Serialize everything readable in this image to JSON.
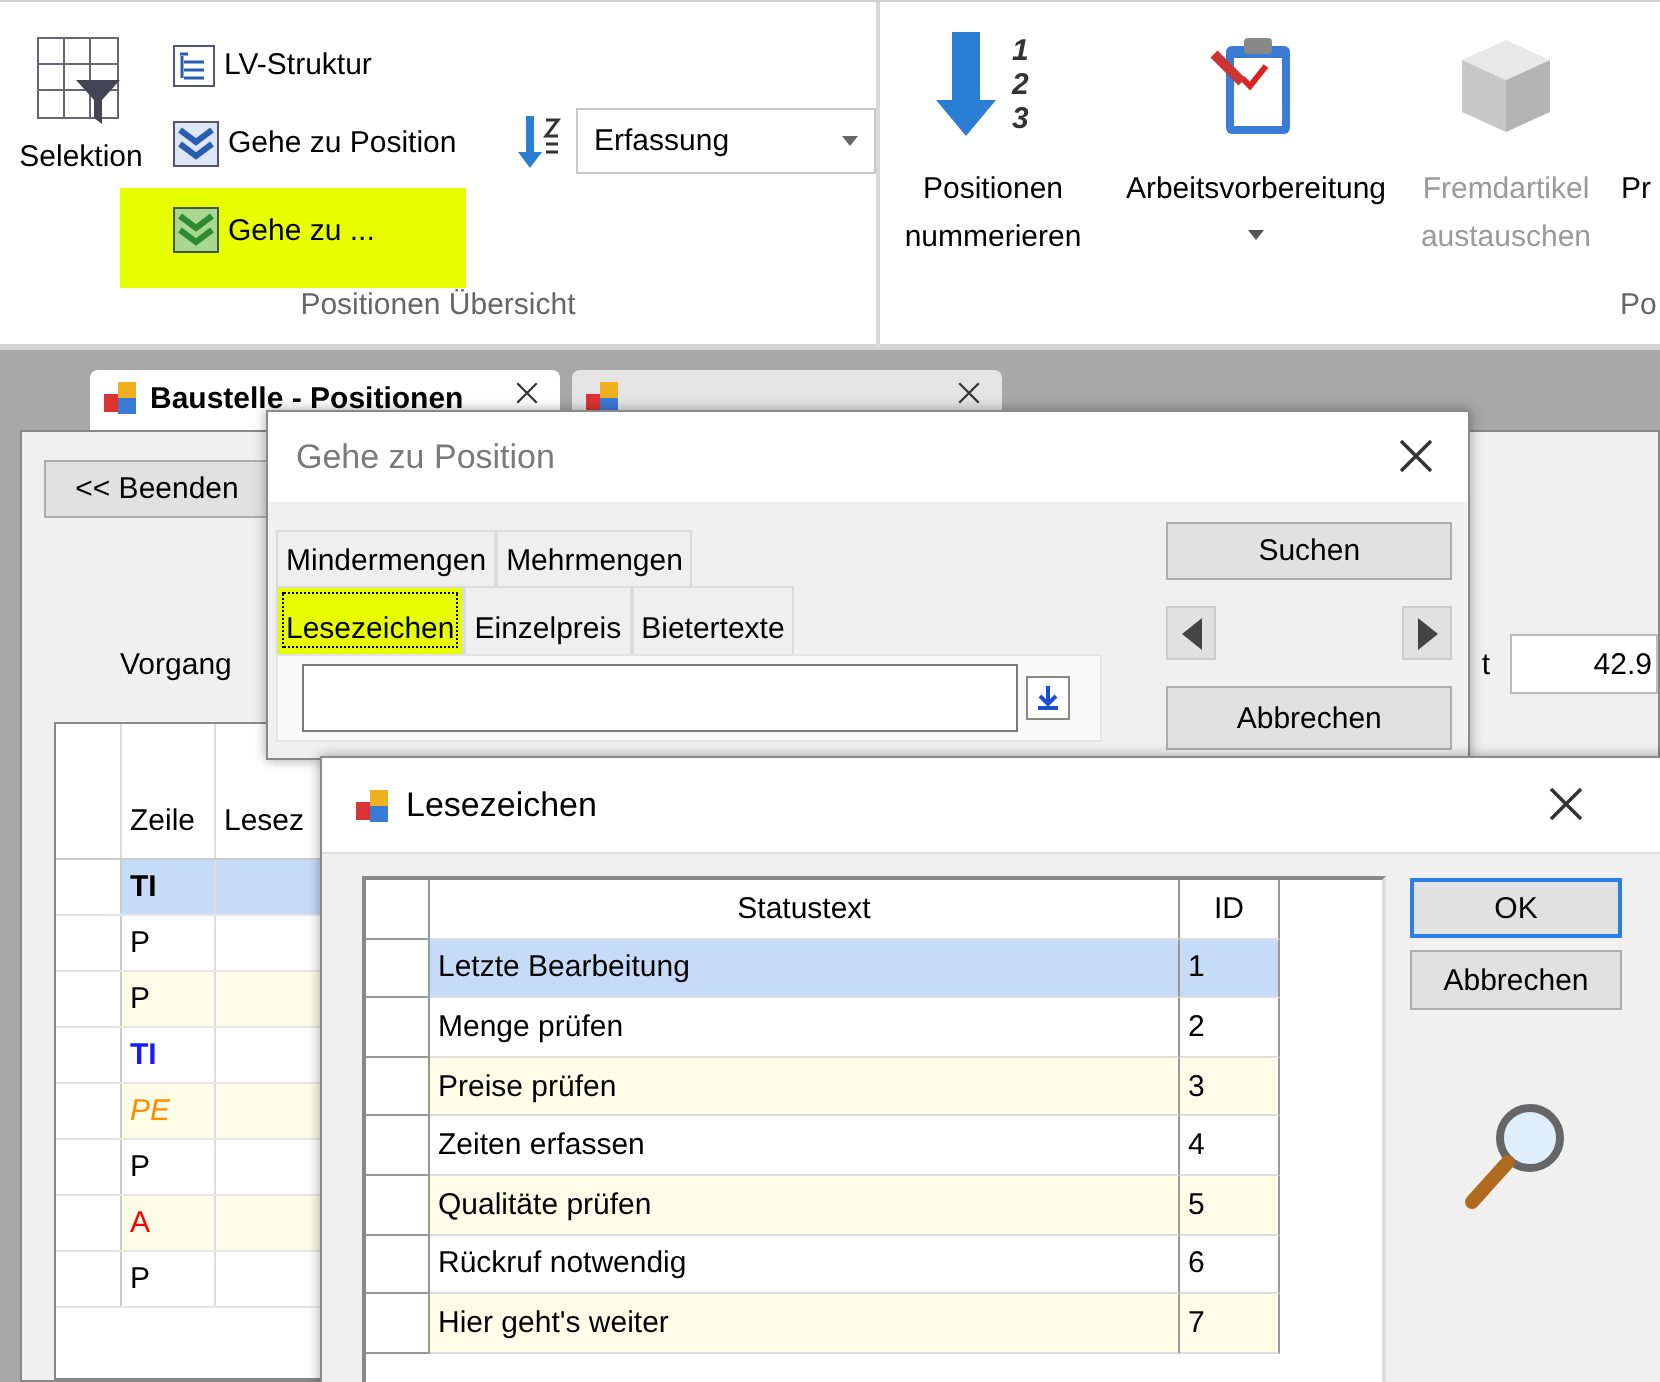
{
  "ribbon": {
    "group_1": {
      "label": "Positionen Übersicht",
      "big_button": {
        "label": "Selektion"
      },
      "small_buttons": [
        {
          "label": "LV-Struktur",
          "kind": "tree",
          "highlighted": false
        },
        {
          "label": "Gehe zu Position",
          "kind": "goto",
          "highlighted": false
        },
        {
          "label": "Gehe zu ...",
          "kind": "goto-green",
          "highlighted": true
        }
      ],
      "sort_combo": {
        "value": "Erfassung"
      }
    },
    "group_2": {
      "label": "Po",
      "buttons": [
        {
          "lines": [
            "Positionen",
            "nummerieren"
          ],
          "kind": "numbering",
          "icon_digits": [
            "1",
            "2",
            "3"
          ],
          "disabled": false,
          "dropdown": false
        },
        {
          "lines": [
            "Arbeitsvorbereitung"
          ],
          "kind": "clipboard",
          "disabled": false,
          "dropdown": true
        },
        {
          "lines": [
            "Fremdartikel",
            "austauschen"
          ],
          "kind": "cube",
          "disabled": true,
          "dropdown": false
        },
        {
          "lines": [
            "Pr"
          ],
          "kind": "none",
          "disabled": false,
          "dropdown": false
        }
      ]
    }
  },
  "document_tabs": [
    {
      "label": "Baustelle - Positionen",
      "selected": true
    },
    {
      "selected": false
    }
  ],
  "main": {
    "back_button": "<< Beenden",
    "vorgang_label": "Vorgang",
    "right_label": "t",
    "right_value": "42.9",
    "grid": {
      "columns": [
        "Zeile",
        "Lesez"
      ],
      "rows": [
        {
          "zeile": "TI",
          "color": "#000000",
          "bold": true,
          "italic": false,
          "selected": true
        },
        {
          "zeile": "P",
          "color": "#000000",
          "bold": false,
          "italic": false,
          "selected": false
        },
        {
          "zeile": "P",
          "color": "#000000",
          "bold": false,
          "italic": false,
          "selected": false
        },
        {
          "zeile": "TI",
          "color": "#1a1aff",
          "bold": true,
          "italic": false,
          "selected": false
        },
        {
          "zeile": "PE",
          "color": "#ff8c00",
          "bold": false,
          "italic": true,
          "selected": false
        },
        {
          "zeile": "P",
          "color": "#000000",
          "bold": false,
          "italic": false,
          "selected": false
        },
        {
          "zeile": "A",
          "color": "#ff0000",
          "bold": false,
          "italic": false,
          "selected": false
        },
        {
          "zeile": "P",
          "color": "#000000",
          "bold": false,
          "italic": false,
          "selected": false
        }
      ]
    }
  },
  "goto_dialog": {
    "title": "Gehe zu Position",
    "tab_rows": [
      [
        {
          "label": "Mindermengen",
          "selected": false,
          "highlighted": false
        },
        {
          "label": "Mehrmengen",
          "selected": false,
          "highlighted": false
        }
      ],
      [
        {
          "label": "Lesezeichen",
          "selected": true,
          "highlighted": true
        },
        {
          "label": "Einzelpreis",
          "selected": false,
          "highlighted": false
        },
        {
          "label": "Bietertexte",
          "selected": false,
          "highlighted": false
        }
      ]
    ],
    "search_button": "Suchen",
    "cancel_button": "Abbrechen"
  },
  "bookmark_dialog": {
    "title": "Lesezeichen",
    "columns": [
      "Statustext",
      "ID"
    ],
    "rows": [
      {
        "statustext": "Letzte Bearbeitung",
        "id": "1",
        "selected": true
      },
      {
        "statustext": "Menge prüfen",
        "id": "2",
        "selected": false
      },
      {
        "statustext": "Preise prüfen",
        "id": "3",
        "selected": false
      },
      {
        "statustext": "Zeiten erfassen",
        "id": "4",
        "selected": false
      },
      {
        "statustext": "Qualitäte prüfen",
        "id": "5",
        "selected": false
      },
      {
        "statustext": "Rückruf notwendig",
        "id": "6",
        "selected": false
      },
      {
        "statustext": "Hier geht's weiter",
        "id": "7",
        "selected": false
      }
    ],
    "buttons": [
      {
        "label": "OK",
        "default": true
      },
      {
        "label": "Abbrechen",
        "default": false
      }
    ]
  }
}
